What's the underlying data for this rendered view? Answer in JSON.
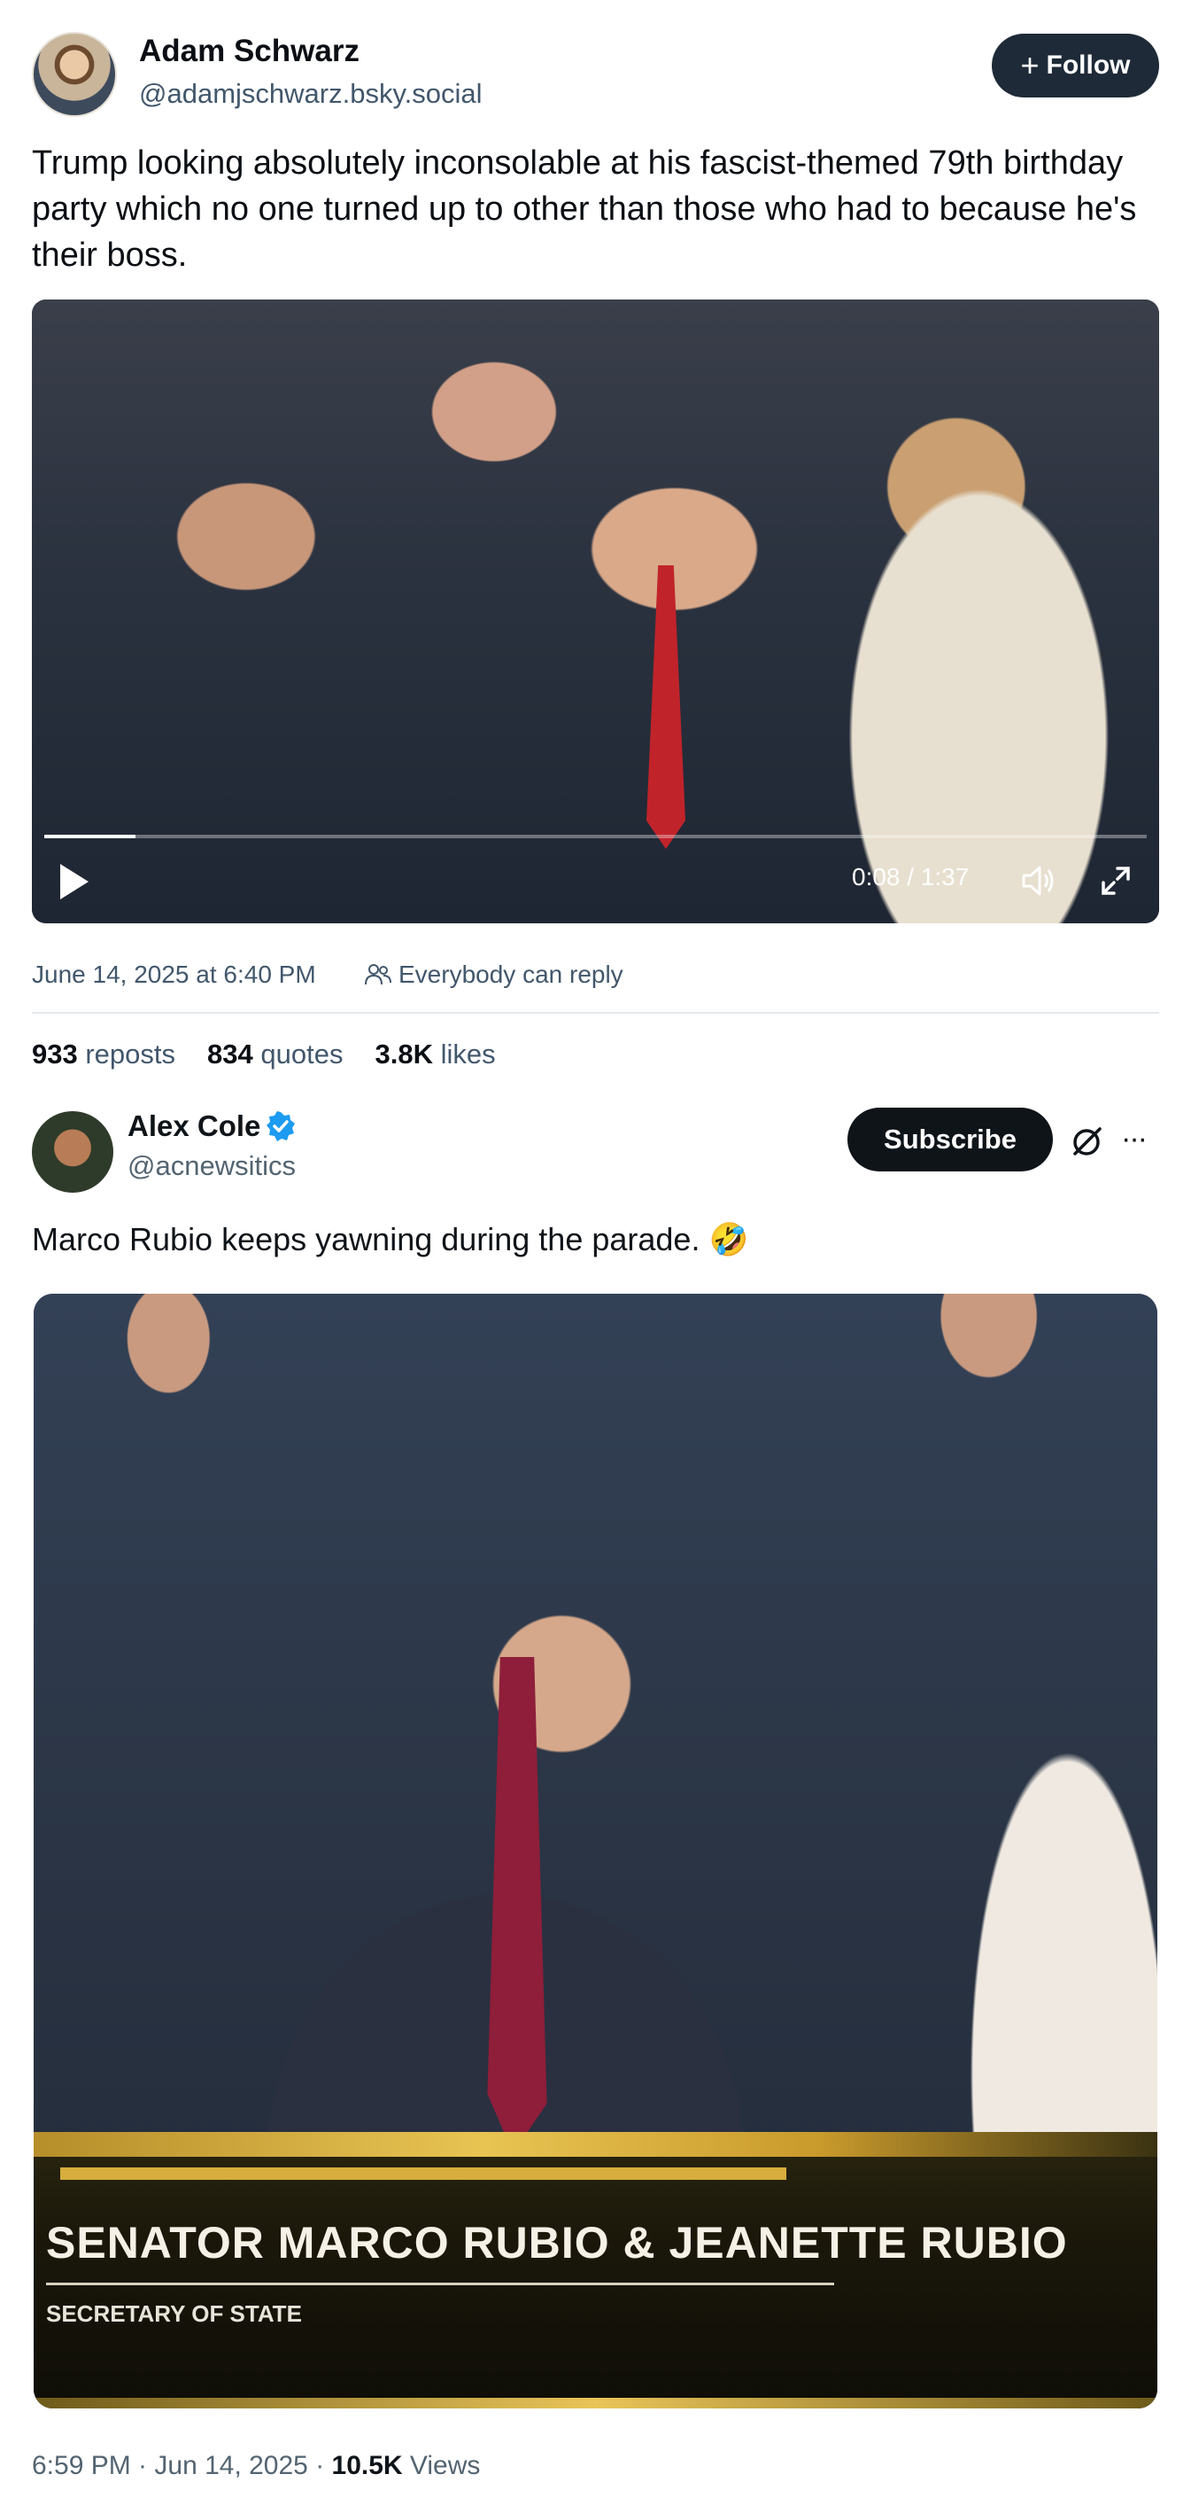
{
  "post1": {
    "author_name": "Adam Schwarz",
    "author_handle": "@adamjschwarz.bsky.social",
    "follow_label": "Follow",
    "text": "Trump looking absolutely inconsolable at his fascist-themed 79th birthday party which no one turned up to other than those who had to because he's their boss.",
    "video": {
      "time": "0:08 / 1:37",
      "progress_fraction": 0.083
    },
    "date": "June 14, 2025 at 6:40 PM",
    "reply_setting": "Everybody can reply",
    "stats": [
      {
        "count": "933",
        "label": "reposts"
      },
      {
        "count": "834",
        "label": "quotes"
      },
      {
        "count": "3.8K",
        "label": "likes"
      }
    ]
  },
  "post2": {
    "author_name": "Alex Cole",
    "author_handle": "@acnewsitics",
    "subscribe_label": "Subscribe",
    "more_label": "···",
    "text": "Marco Rubio keeps yawning during the parade. 🤣",
    "lower_third": {
      "name": "SENATOR MARCO RUBIO & JEANETTE RUBIO",
      "role": "SECRETARY OF STATE"
    },
    "time_date": "6:59 PM · Jun 14, 2025 · ",
    "views_count": "10.5K",
    "views_label": " Views"
  },
  "colors": {
    "follow_bg": "#1e2a38",
    "verified": "#1d9bf0",
    "tie": "#c1232a"
  },
  "icons": [
    "play-icon",
    "volume-icon",
    "fullscreen-icon",
    "people-icon",
    "verified-badge-icon",
    "grok-icon",
    "more-icon"
  ]
}
